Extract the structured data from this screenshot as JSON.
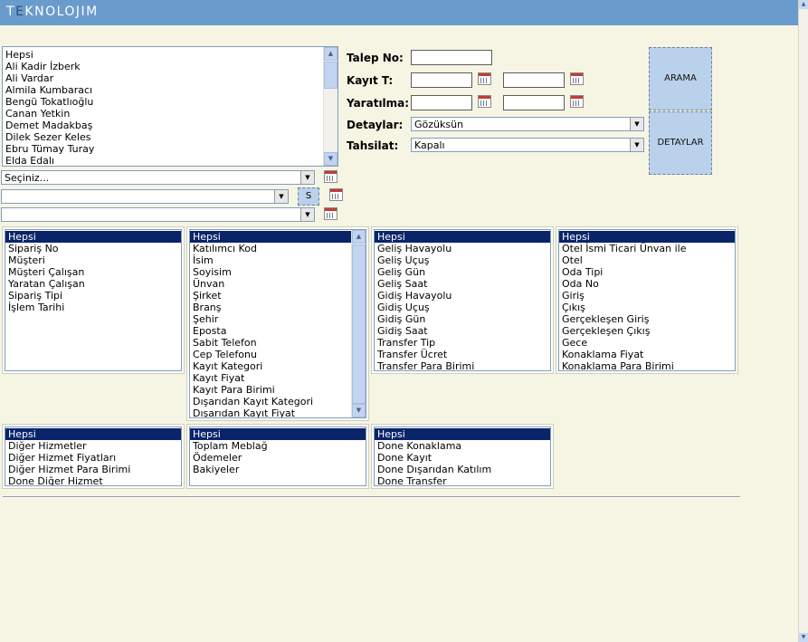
{
  "header": {
    "logo_pre": "T",
    "logo_e": "E",
    "logo_post": "KNOLOJIM"
  },
  "users_list": {
    "items": [
      "Hepsi",
      "Ali Kadir İzberk",
      "Ali Vardar",
      "Almila Kumbaracı",
      "Bengü Tokatlıoğlu",
      "Canan Yetkin",
      "Demet Madakbaş",
      "Dilek Sezer Keles",
      "Ebru Tümay Turay",
      "Elda Edalı"
    ]
  },
  "selects": {
    "select1": "Seçiniz...",
    "select2": "",
    "select3": ""
  },
  "s_button": "S",
  "form": {
    "talep_no_label": "Talep No:",
    "kayit_label": "Kayıt T:",
    "yaratilma_label": "Yaratılma:",
    "detaylar_label": "Detaylar:",
    "detaylar_value": "Gözüksün",
    "tahsilat_label": "Tahsilat:",
    "tahsilat_value": "Kapalı"
  },
  "buttons": {
    "arama": "ARAMA",
    "detaylar": "DETAYLAR"
  },
  "lists": {
    "list1": [
      "Hepsi",
      "Sipariş No",
      "Müşteri",
      "Müşteri Çalışan",
      "Yaratan Çalışan",
      "Sipariş Tipi",
      "İşlem Tarihi"
    ],
    "list2": [
      "Hepsi",
      "Katılımcı Kod",
      "İsim",
      "Soyisim",
      "Ünvan",
      "Şirket",
      "Branş",
      "Şehir",
      "Eposta",
      "Sabit Telefon",
      "Cep Telefonu",
      "Kayıt Kategori",
      "Kayıt Fiyat",
      "Kayıt Para Birimi",
      "Dışarıdan Kayıt Kategori",
      "Dışarıdan Kayıt Fiyat"
    ],
    "list3": [
      "Hepsi",
      "Geliş Havayolu",
      "Geliş Uçuş",
      "Geliş Gün",
      "Geliş Saat",
      "Gidiş Havayolu",
      "Gidiş Uçuş",
      "Gidiş Gün",
      "Gidiş Saat",
      "Transfer Tip",
      "Transfer Ücret",
      "Transfer Para Birimi"
    ],
    "list4": [
      "Hepsi",
      "Otel İsmi Ticari Ünvan ile",
      "Otel",
      "Oda Tipi",
      "Oda No",
      "Giriş",
      "Çıkış",
      "Gerçekleşen Giriş",
      "Gerçekleşen Çıkış",
      "Gece",
      "Konaklama Fiyat",
      "Konaklama Para Birimi"
    ],
    "list5": [
      "Hepsi",
      "Diğer Hizmetler",
      "Diğer Hizmet Fiyatları",
      "Diğer Hizmet Para Birimi",
      "Done Diğer Hizmet"
    ],
    "list6": [
      "Hepsi",
      "Toplam Meblağ",
      "Ödemeler",
      "Bakiyeler"
    ],
    "list7": [
      "Hepsi",
      "Done Konaklama",
      "Done Kayıt",
      "Done Dışarıdan Katılım",
      "Done Transfer"
    ]
  },
  "icons": {
    "scroll_up": "▲",
    "scroll_down": "▼",
    "dropdown": "▼"
  }
}
